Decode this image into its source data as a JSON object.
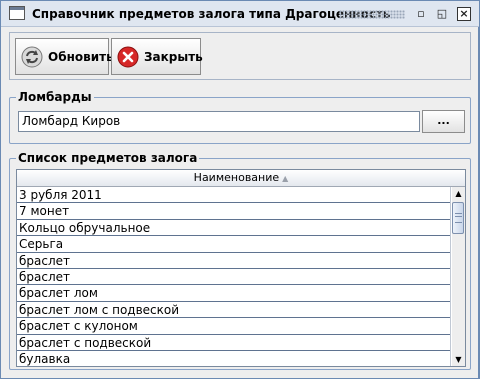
{
  "window": {
    "title": "Справочник предметов залога типа Драгоценность",
    "controls": {
      "minimize": "▫",
      "maximize": "◱",
      "close": "×"
    }
  },
  "toolbar": {
    "refresh_label": "Обновить",
    "close_label": "Закрыть",
    "refresh_icon": "refresh-icon",
    "close_icon": "close-icon"
  },
  "pawnshops": {
    "title": "Ломбарды",
    "value": "Ломбард Киров",
    "browse_label": "..."
  },
  "items_list": {
    "title": "Список предметов залога",
    "column_header": "Наименование",
    "sort_indicator": "▲",
    "rows": [
      "3 рубля 2011",
      "7  монет",
      "Кольцо обручальное",
      "Серьга",
      "браслет",
      "браслет",
      "браслет лом",
      "браслет лом с подвеской",
      "браслет с кулоном",
      "браслет с подвеской",
      "булавка"
    ]
  },
  "scrollbar": {
    "up": "▲",
    "down": "▼"
  },
  "colors": {
    "window_bg": "#eeeeee",
    "border_blue": "#8aa4c8",
    "row_divider": "#5f7390"
  }
}
